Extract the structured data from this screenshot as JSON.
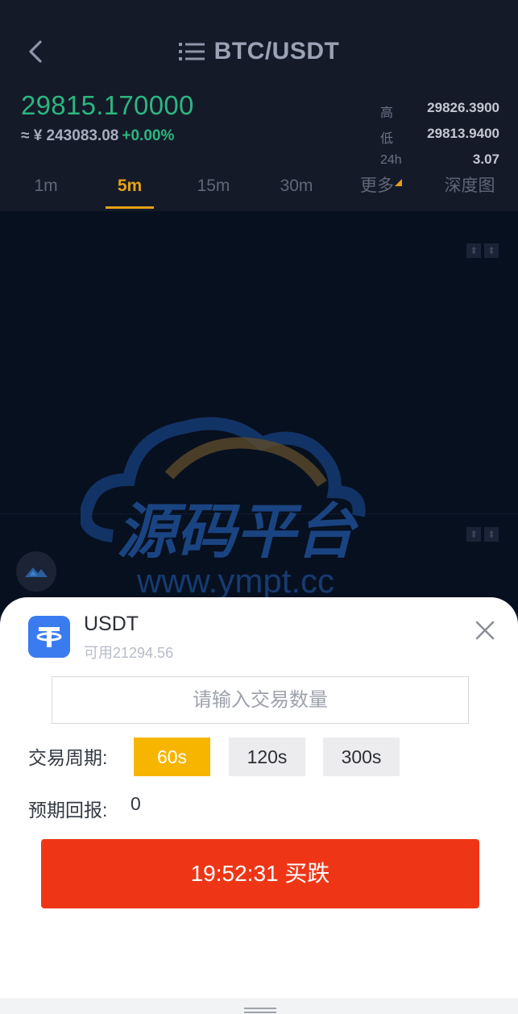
{
  "header": {
    "title": "BTC/USDT",
    "price": "29815.170000",
    "price_cny": "≈ ¥ 243083.08",
    "change": "+0.00%",
    "stats": [
      {
        "label": "高",
        "value": "29826.3900"
      },
      {
        "label": "低",
        "value": "29813.9400"
      },
      {
        "label": "24h",
        "value": "3.07"
      }
    ]
  },
  "tabs": [
    {
      "label": "1m"
    },
    {
      "label": "5m"
    },
    {
      "label": "15m"
    },
    {
      "label": "30m"
    },
    {
      "label": "更多"
    },
    {
      "label": "深度图"
    }
  ],
  "active_tab": "5m",
  "watermark": {
    "text_cn": "源码平台",
    "text_url": "www.ympt.cc"
  },
  "colors": {
    "up": "#2bb67f",
    "accent": "#e3a214",
    "sell": "#ee3617",
    "period_active": "#f7b500",
    "coin": "#3a7cf0"
  },
  "trade": {
    "coin": "USDT",
    "available": "可用21294.56",
    "amount_placeholder": "请输入交易数量",
    "period_label": "交易周期:",
    "periods": [
      {
        "label": "60s"
      },
      {
        "label": "120s"
      },
      {
        "label": "300s"
      }
    ],
    "selected_period": "60s",
    "return_label": "预期回报:",
    "return_value": "0",
    "submit_label": "19:52:31 买跌"
  },
  "icons": {
    "back": "chevron-left-icon",
    "menu": "list-icon",
    "close": "close-icon",
    "coin": "tether-icon",
    "chart_fab": "mountain-icon"
  }
}
